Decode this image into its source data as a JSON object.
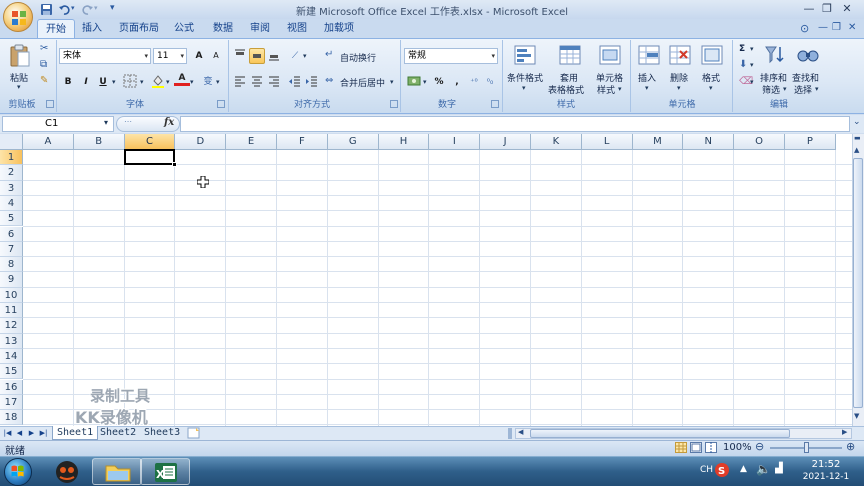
{
  "window": {
    "title": "新建 Microsoft Office Excel 工作表.xlsx - Microsoft Excel",
    "controls": {
      "minimize": "—",
      "restore": "❐",
      "close": "✕"
    },
    "qat": [
      "save-icon",
      "undo-icon",
      "redo-icon",
      "customize-icon"
    ]
  },
  "tabs": [
    {
      "label": "开始",
      "active": true
    },
    {
      "label": "插入"
    },
    {
      "label": "页面布局"
    },
    {
      "label": "公式"
    },
    {
      "label": "数据"
    },
    {
      "label": "审阅"
    },
    {
      "label": "视图"
    },
    {
      "label": "加载项"
    }
  ],
  "ribbon": {
    "clipboard": {
      "label": "剪贴板",
      "paste": "粘贴"
    },
    "font": {
      "label": "字体",
      "name": "宋体",
      "size": "11",
      "bold": "B",
      "italic": "I",
      "underline": "U",
      "grow": "A",
      "shrink": "A",
      "font_color": "A",
      "phonetic": "变"
    },
    "alignment": {
      "label": "对齐方式",
      "wrap": "自动换行",
      "merge": "合并后居中"
    },
    "number": {
      "label": "数字",
      "format": "常规",
      "percent": "%",
      "comma": ","
    },
    "styles": {
      "label": "样式",
      "conditional": "条件格式",
      "table_1": "套用",
      "table_2": "表格格式",
      "cell_styles_1": "单元格",
      "cell_styles_2": "样式"
    },
    "cells": {
      "label": "单元格",
      "insert": "插入",
      "delete": "删除",
      "format": "格式"
    },
    "editing": {
      "label": "编辑",
      "sort_1": "排序和",
      "sort_2": "筛选",
      "find_1": "查找和",
      "find_2": "选择",
      "sigma": "Σ"
    }
  },
  "formula_bar": {
    "name_box": "C1",
    "fx": "fx",
    "value": ""
  },
  "grid": {
    "columns": [
      "A",
      "B",
      "C",
      "D",
      "E",
      "F",
      "G",
      "H",
      "I",
      "J",
      "K",
      "L",
      "M",
      "N",
      "O",
      "P"
    ],
    "rows": [
      "1",
      "2",
      "3",
      "4",
      "5",
      "6",
      "7",
      "8",
      "9",
      "10",
      "11",
      "12",
      "13",
      "14",
      "15",
      "16",
      "17",
      "18"
    ],
    "active_cell": "C1"
  },
  "watermark": {
    "line1": "录制工具",
    "line2": "KK录像机"
  },
  "sheets": [
    {
      "name": "Sheet1",
      "active": true
    },
    {
      "name": "Sheet2"
    },
    {
      "name": "Sheet3"
    }
  ],
  "status": {
    "ready": "就绪",
    "zoom": "100%"
  },
  "taskbar": {
    "apps": [
      "start-icon",
      "kk-recorder-icon",
      "explorer-icon",
      "excel-icon"
    ],
    "tray_lang": "CH",
    "time": "21:52",
    "date": "2021-12-1"
  },
  "colors": {
    "accent": "#f8c15d",
    "ribbon": "#dbe7f5",
    "header_border": "#9eb6ce",
    "taskbar": "#2f5f8a"
  }
}
